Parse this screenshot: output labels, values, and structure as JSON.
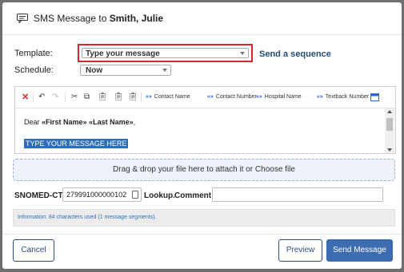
{
  "header": {
    "title_prefix": "SMS Message to ",
    "recipient": "Smith, Julie"
  },
  "form": {
    "template_label": "Template:",
    "template_value": "Type your message",
    "send_sequence_link": "Send a sequence",
    "schedule_label": "Schedule:",
    "schedule_value": "Now"
  },
  "toolbar": {
    "contact_name": "Contact Name",
    "contact_number": "Contact Number",
    "hospital_name": "Hospital Name",
    "textback_number": "Textback Number",
    "placeholder_prefix": "«»"
  },
  "editor": {
    "greeting": "Dear",
    "first_name_field": "«First Name»",
    "last_name_field": "«Last Name»",
    "greeting_end": ",",
    "selected_text": "TYPE YOUR MESSAGE HERE"
  },
  "attachment": {
    "drop_text": "Drag & drop your file here to attach it or Choose file"
  },
  "snomed": {
    "label": "SNOMED-CT:",
    "value": "279991000000102",
    "lookup_label": "Lookup.",
    "comment_label": "Comment:",
    "comment_value": ""
  },
  "info": {
    "text": "Information: 84 characters used (1 message segments)."
  },
  "buttons": {
    "cancel": "Cancel",
    "preview": "Preview",
    "send": "Send Message"
  },
  "colors": {
    "accent": "#3d6db0",
    "highlight_border": "#d7262e",
    "selection": "#2e6eb9"
  }
}
